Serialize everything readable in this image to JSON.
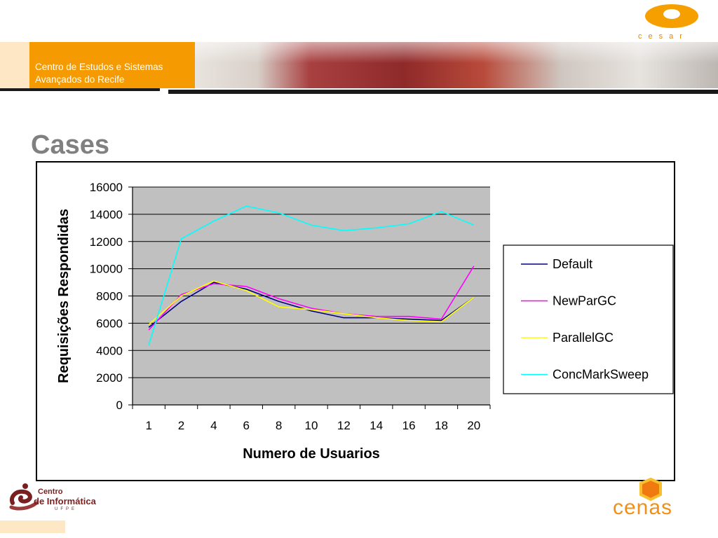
{
  "header": {
    "org_name_line1": "Centro de Estudos e Sistemas",
    "org_name_line2": "Avançados do Recife",
    "logo_text": "cesar"
  },
  "slide": {
    "title": "Cases"
  },
  "footer": {
    "left_logo_line1": "Centro",
    "left_logo_line2": "de Informática",
    "left_logo_line3": "UFPE",
    "right_logo_text": "cenas"
  },
  "colors": {
    "accent_orange": "#f59a00",
    "plot_background": "#c0c0c0",
    "default": "#000080",
    "newpargc": "#ff00ff",
    "parallelgc": "#ffff00",
    "concmarksweep": "#00ffff"
  },
  "chart_data": {
    "type": "line",
    "title": "",
    "xlabel": "Numero de Usuarios",
    "ylabel": "Requisições Respondidas",
    "categories": [
      "1",
      "2",
      "4",
      "6",
      "8",
      "10",
      "12",
      "14",
      "16",
      "18",
      "20"
    ],
    "ylim": [
      0,
      16000
    ],
    "yticks": [
      0,
      2000,
      4000,
      6000,
      8000,
      10000,
      12000,
      14000,
      16000
    ],
    "grid": "horizontal",
    "legend_position": "right",
    "series": [
      {
        "name": "Default",
        "color": "#000080",
        "values": [
          5700,
          7600,
          9000,
          8500,
          7600,
          6900,
          6400,
          6400,
          6300,
          6200,
          7900
        ]
      },
      {
        "name": "NewParGC",
        "color": "#ff00ff",
        "values": [
          5500,
          8100,
          8900,
          8700,
          7800,
          7100,
          6700,
          6500,
          6500,
          6300,
          10200
        ]
      },
      {
        "name": "ParallelGC",
        "color": "#ffff00",
        "values": [
          5900,
          8000,
          9100,
          8400,
          7200,
          7000,
          6700,
          6400,
          6200,
          6100,
          7900
        ]
      },
      {
        "name": "ConcMarkSweep",
        "color": "#00ffff",
        "values": [
          4400,
          12200,
          13500,
          14600,
          14100,
          13200,
          12800,
          13000,
          13300,
          14200,
          13200
        ]
      }
    ]
  }
}
